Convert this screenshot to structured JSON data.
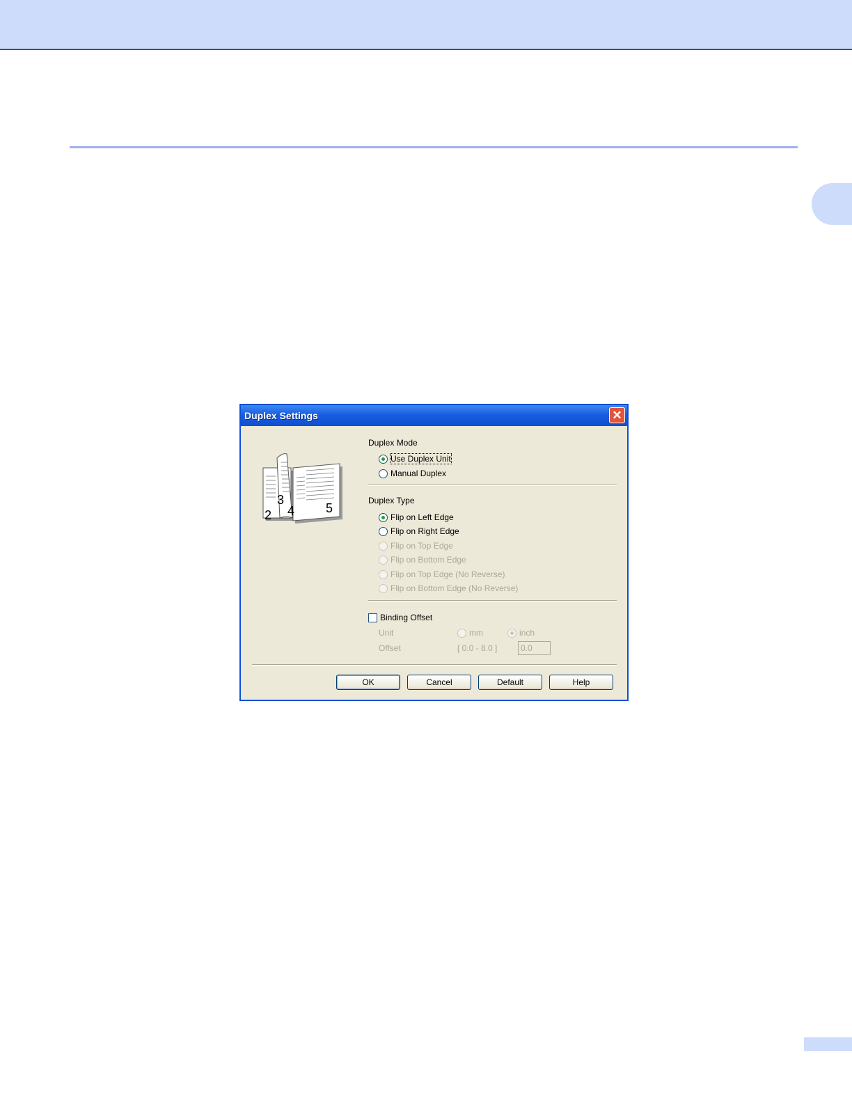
{
  "dialog": {
    "title": "Duplex Settings",
    "illustration_numbers": [
      "3",
      "2",
      "4",
      "5"
    ],
    "duplex_mode": {
      "label": "Duplex Mode",
      "options": [
        {
          "label": "Use Duplex Unit",
          "checked": true,
          "enabled": true
        },
        {
          "label": "Manual Duplex",
          "checked": false,
          "enabled": true
        }
      ]
    },
    "duplex_type": {
      "label": "Duplex Type",
      "options": [
        {
          "label": "Flip on Left Edge",
          "checked": true,
          "enabled": true
        },
        {
          "label": "Flip on Right Edge",
          "checked": false,
          "enabled": true
        },
        {
          "label": "Flip on Top Edge",
          "checked": false,
          "enabled": false
        },
        {
          "label": "Flip on Bottom Edge",
          "checked": false,
          "enabled": false
        },
        {
          "label": "Flip on Top Edge (No Reverse)",
          "checked": false,
          "enabled": false
        },
        {
          "label": "Flip on Bottom Edge (No Reverse)",
          "checked": false,
          "enabled": false
        }
      ]
    },
    "binding_offset": {
      "label": "Binding Offset",
      "checked": false,
      "unit_label": "Unit",
      "unit_options": [
        {
          "label": "mm",
          "checked": false
        },
        {
          "label": "inch",
          "checked": true
        }
      ],
      "offset_label": "Offset",
      "offset_range": "[ 0.0 - 8.0 ]",
      "offset_value": "0.0"
    },
    "buttons": {
      "ok": "OK",
      "cancel": "Cancel",
      "default": "Default",
      "help": "Help"
    },
    "close_icon": "close-icon"
  },
  "colors": {
    "title_bar": "#1a5de0",
    "dialog_face": "#ece9d8",
    "page_accent": "#cedcfc",
    "rule": "#9ab2ef"
  }
}
